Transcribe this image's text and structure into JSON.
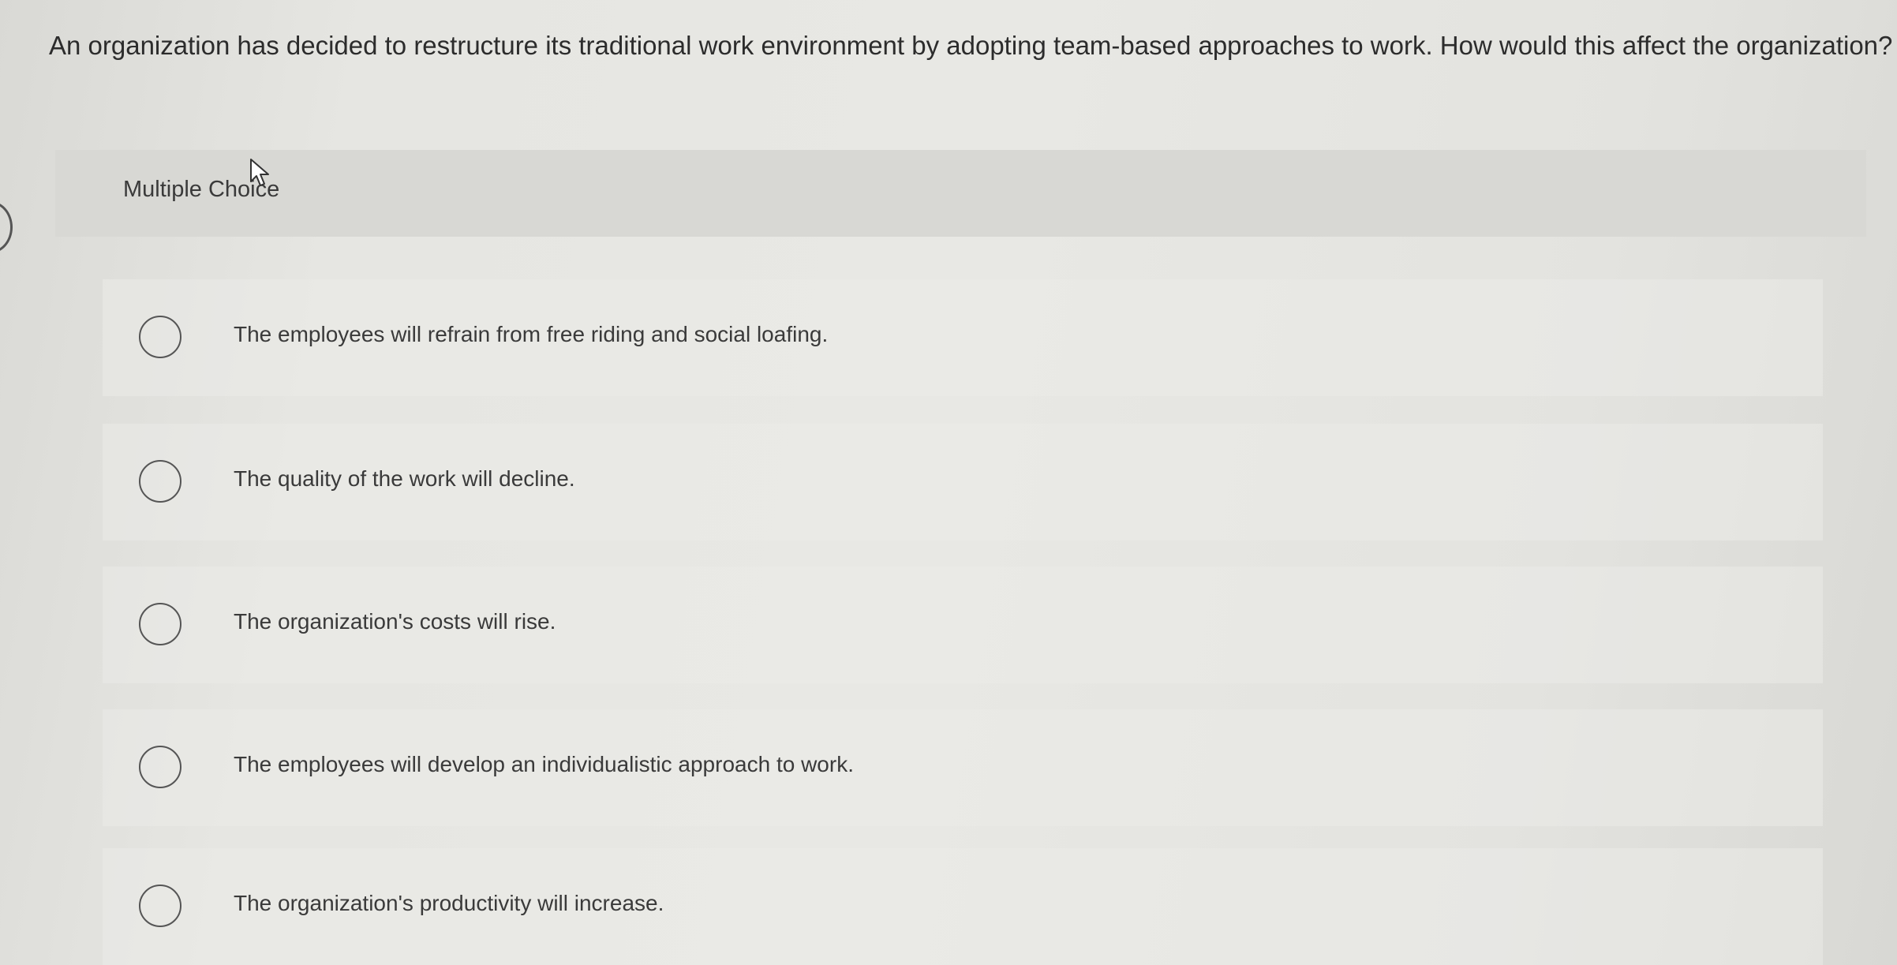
{
  "question": {
    "text": "An organization has decided to restructure its traditional work environment by adopting team-based approaches to work. How would this affect the organization?"
  },
  "section": {
    "label": "Multiple Choice"
  },
  "options": [
    {
      "label": "The employees will refrain from free riding and social loafing."
    },
    {
      "label": "The quality of the work will decline."
    },
    {
      "label": "The organization's costs will rise."
    },
    {
      "label": "The employees will develop an individualistic approach to work."
    },
    {
      "label": "The organization's productivity will increase."
    }
  ],
  "icons": {
    "cursor": "mouse-pointer-icon",
    "radio": "radio-button-icon"
  }
}
